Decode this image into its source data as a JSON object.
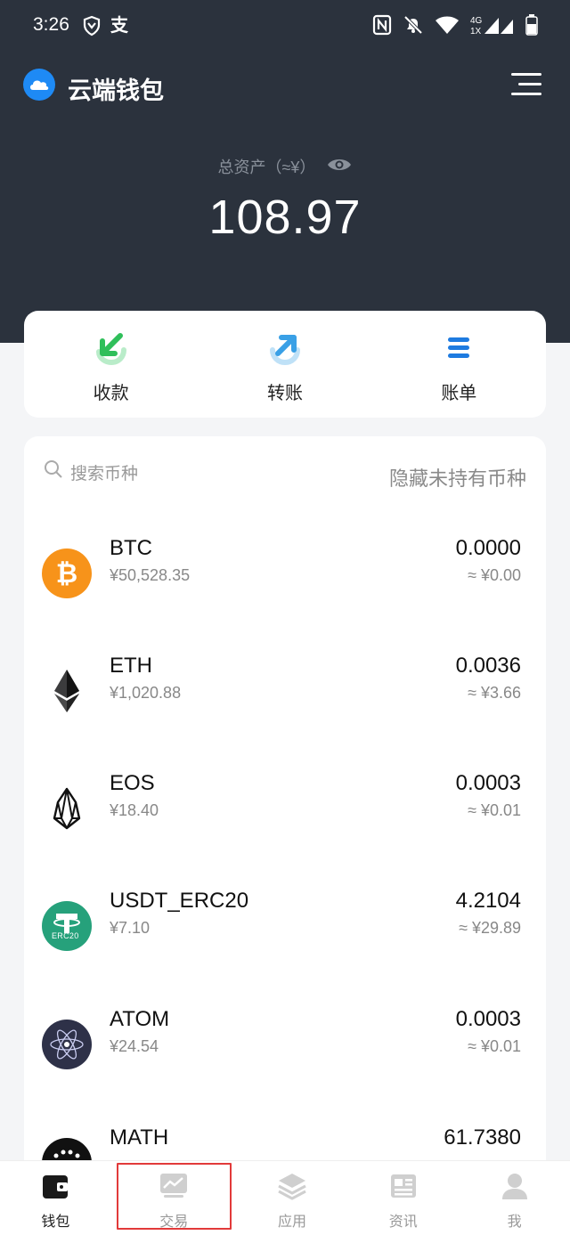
{
  "status_bar": {
    "time": "3:26",
    "alipay_glyph": "支"
  },
  "app": {
    "title": "云端钱包"
  },
  "summary": {
    "label": "总资产（≈¥）",
    "total": "108.97"
  },
  "actions": [
    {
      "label": "收款",
      "icon": "receive-icon"
    },
    {
      "label": "转账",
      "icon": "transfer-icon"
    },
    {
      "label": "账单",
      "icon": "bill-icon"
    }
  ],
  "search": {
    "placeholder": "搜索币种",
    "hide_label": "隐藏未持有币种"
  },
  "coins": [
    {
      "symbol": "BTC",
      "price": "¥50,528.35",
      "amount": "0.0000",
      "value": "≈ ¥0.00"
    },
    {
      "symbol": "ETH",
      "price": "¥1,020.88",
      "amount": "0.0036",
      "value": "≈ ¥3.66"
    },
    {
      "symbol": "EOS",
      "price": "¥18.40",
      "amount": "0.0003",
      "value": "≈ ¥0.01"
    },
    {
      "symbol": "USDT_ERC20",
      "price": "¥7.10",
      "amount": "4.2104",
      "value": "≈ ¥29.89"
    },
    {
      "symbol": "ATOM",
      "price": "¥24.54",
      "amount": "0.0003",
      "value": "≈ ¥0.01"
    },
    {
      "symbol": "MATH",
      "price": "",
      "amount": "61.7380",
      "value": ""
    }
  ],
  "usdt_badge": "ERC20",
  "tabs": [
    {
      "label": "钱包",
      "icon": "wallet-icon"
    },
    {
      "label": "交易",
      "icon": "chart-icon"
    },
    {
      "label": "应用",
      "icon": "layers-icon"
    },
    {
      "label": "资讯",
      "icon": "news-icon"
    },
    {
      "label": "我",
      "icon": "user-icon"
    }
  ],
  "colors": {
    "header_bg": "#2b323d",
    "receive_green": "#2fbf5a",
    "transfer_blue": "#39a0e6",
    "bill_blue": "#1e7be0",
    "btc_orange": "#f7931a",
    "usdt_green": "#26a17b",
    "highlight_red": "#e23a3a"
  }
}
